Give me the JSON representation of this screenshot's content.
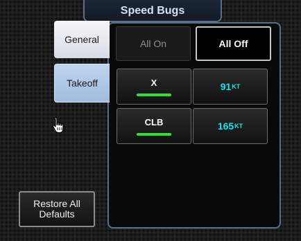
{
  "window": {
    "title": "Speed Bugs"
  },
  "tabs": [
    {
      "label": "General",
      "state": "inactive"
    },
    {
      "label": "Takeoff",
      "state": "selected"
    }
  ],
  "toolbar": {
    "all_on_label": "All On",
    "all_on_state": "disabled",
    "all_off_label": "All Off"
  },
  "bugs": [
    {
      "name": "X",
      "value": "91",
      "unit": "KT",
      "enabled": true
    },
    {
      "name": "CLB",
      "value": "165",
      "unit": "KT",
      "enabled": true
    }
  ],
  "footer": {
    "restore_line1": "Restore All",
    "restore_line2": "Defaults"
  },
  "colors": {
    "panel_border": "#5b6e86",
    "value_text": "#18e4e8",
    "enabled_bar": "#33dd33",
    "selected_tab": "#afc8e6"
  },
  "icons": {
    "cursor": "hand-pointer-icon"
  }
}
